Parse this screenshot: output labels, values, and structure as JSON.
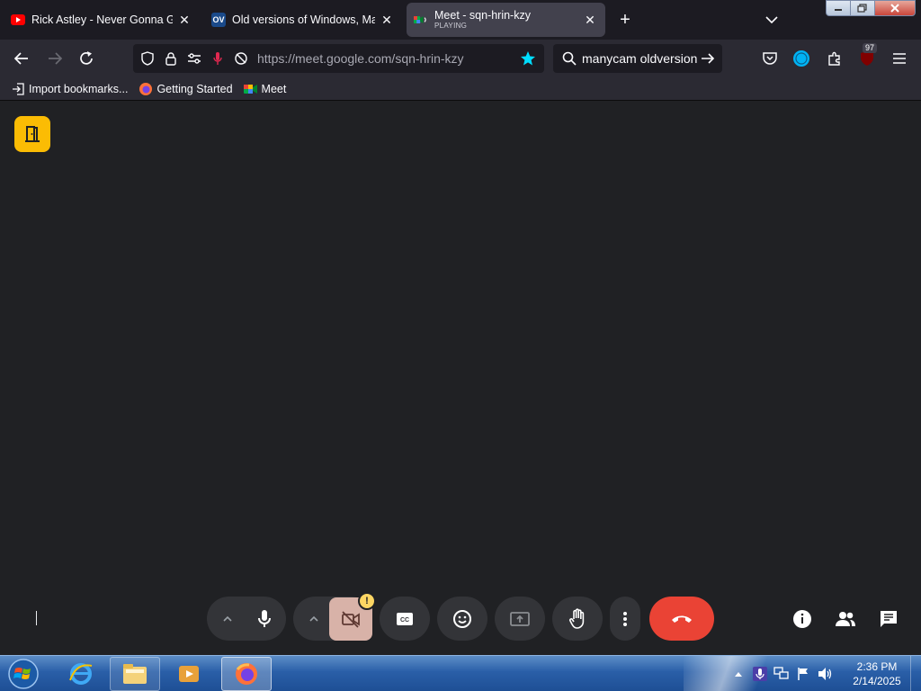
{
  "browser": {
    "tabs": [
      {
        "title": "Rick Astley - Never Gonna Give",
        "favicon": "youtube-icon"
      },
      {
        "title": "Old versions of Windows, Mac",
        "favicon_text": "OV"
      },
      {
        "title": "Meet - sqn-hrin-kzy",
        "subtitle": "PLAYING",
        "favicon": "meet-icon",
        "active": true
      }
    ],
    "url_host": "https://meet.google.com/",
    "url_path": "sqn-hrin-kzy",
    "search_query": "manycam oldversion",
    "extension_badge": "97",
    "bookmarks": [
      {
        "label": "Import bookmarks..."
      },
      {
        "label": "Getting Started"
      },
      {
        "label": "Meet"
      }
    ]
  },
  "meet": {
    "camera_warning": "!"
  },
  "taskbar": {
    "time": "2:36 PM",
    "date": "2/14/2025"
  },
  "colors": {
    "meet_bg": "#202124",
    "end_call": "#ea4335",
    "exit_button": "#fbbc04",
    "camera_off": "#d8b2a8"
  }
}
